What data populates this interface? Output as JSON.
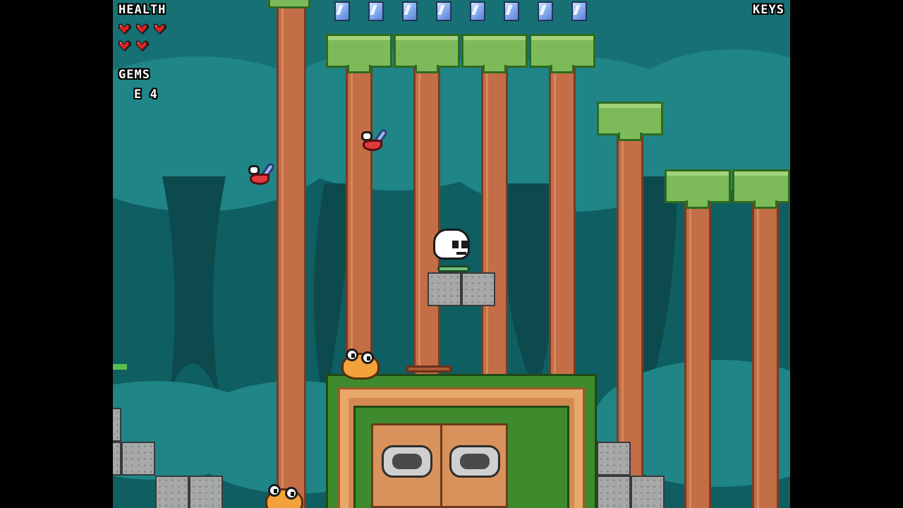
{
  "hud": {
    "health_label": "HEALTH",
    "health_hearts": 5,
    "gems_label": "GEMS",
    "gems_value": "E 4",
    "keys_label": "KEYS"
  },
  "colors": {
    "background": "#0f5e61",
    "foliage": "#1d7f80",
    "trunk": "#c46e47",
    "canopy": "#7dba5a",
    "heart": "#e02424",
    "gem": "#8ab0f0"
  },
  "world": {
    "ceiling_gems_count": 8,
    "player": "skull-hero",
    "enemies": [
      "red-fly",
      "red-fly",
      "orange-blob",
      "orange-blob"
    ]
  }
}
